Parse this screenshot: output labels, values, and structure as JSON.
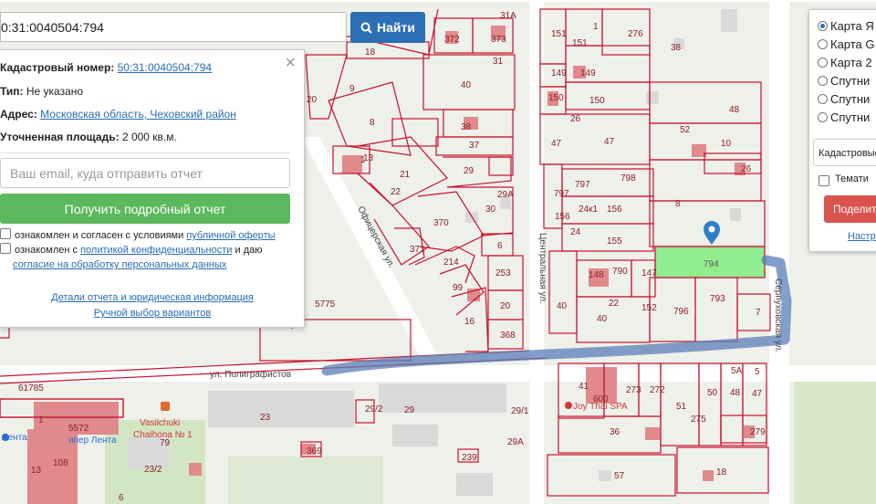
{
  "search": {
    "value": "0:31:0040504:794",
    "button_label": "Найти"
  },
  "info": {
    "cadastral_label": "Кадастровый номер:",
    "cadastral_value": "50:31:0040504:794",
    "type_label": "Тип:",
    "type_value": "Не указано",
    "address_label": "Адрес:",
    "address_value": "Московская область, Чеховский район",
    "area_label": "Уточненная площадь:",
    "area_value": "2 000 кв.м.",
    "email_placeholder": "Ваш email, куда отправить отчет",
    "report_button": "Получить подробный отчет",
    "consent1_pre": "ознакомлен и согласен с условиями",
    "consent1_link": "публичной оферты",
    "consent2_pre": "ознакомлен с",
    "consent2_link": "политикой конфиденциальности",
    "consent2_mid": "и даю",
    "consent2_link2": "согласие на обработку персональных данных",
    "details_link": "Детали отчета и юридическая информация",
    "manual_link": "Ручной выбор вариантов"
  },
  "layers": {
    "options": [
      "Карта Я",
      "Карта G",
      "Карта 2",
      "Спутни",
      "Спутни",
      "Спутни"
    ],
    "selected_index": 0,
    "cadastral_select": "Кадастровые",
    "thematic_label": "Темати",
    "share_button": "Поделит",
    "settings_link": "Настр"
  },
  "map": {
    "streets": [
      "ул. Полиграфистов",
      "Офицерская ул.",
      "Центральная ул.",
      "Серпуховская ул."
    ],
    "selected_parcel": "794",
    "pois": [
      "Joy Thai SPA",
      "Vasilchuki",
      "Chaihona № 1",
      "Лента",
      "ипер Лента"
    ],
    "parcels": [
      "372",
      "373",
      "18",
      "31",
      "31А",
      "9",
      "40",
      "20",
      "8",
      "38",
      "37",
      "13",
      "1",
      "21",
      "29",
      "29А",
      "30",
      "22",
      "370",
      "371",
      "214",
      "6",
      "253",
      "99",
      "20",
      "16",
      "368",
      "5775",
      "151",
      "151",
      "1",
      "276",
      "38",
      "149",
      "149",
      "150",
      "150",
      "26",
      "47",
      "47",
      "48",
      "52",
      "10",
      "26",
      "797",
      "797",
      "798",
      "24к1",
      "156",
      "156",
      "8",
      "24",
      "155",
      "148",
      "790",
      "147",
      "794",
      "40",
      "22",
      "152",
      "40",
      "796",
      "793",
      "7",
      "61785",
      "41",
      "600",
      "273",
      "272",
      "51",
      "50",
      "48",
      "47",
      "5А",
      "5",
      "275",
      "279",
      "36",
      "18",
      "57",
      "29/2",
      "29",
      "29/1",
      "23",
      "369",
      "239",
      "29А",
      "23/2",
      "1",
      "5572",
      "13",
      "108",
      "79",
      "6"
    ]
  }
}
